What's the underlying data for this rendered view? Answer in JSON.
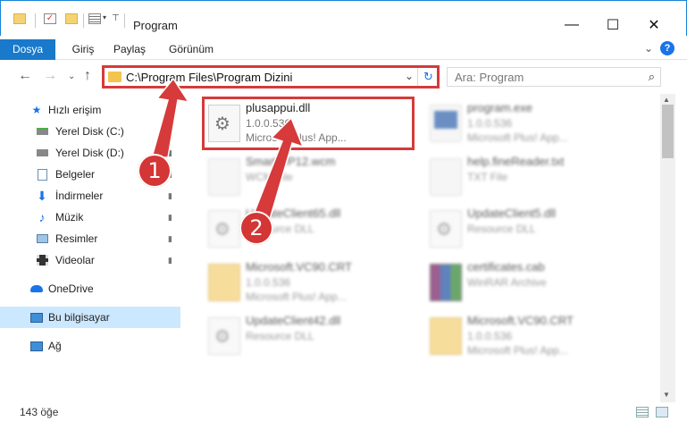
{
  "window": {
    "title": "Program",
    "minimize": "—",
    "maximize": "☐",
    "close": "✕"
  },
  "ribbon": {
    "tabs": [
      {
        "label": "Dosya",
        "active": true
      },
      {
        "label": "Giriş",
        "active": false
      },
      {
        "label": "Paylaş",
        "active": false
      },
      {
        "label": "Görünüm",
        "active": false
      }
    ],
    "expand_icon": "⌄",
    "help": "?"
  },
  "navigation": {
    "back": "←",
    "forward": "→",
    "recent": "⌄",
    "up": "↑"
  },
  "address": {
    "path": "C:\\Program Files\\Program Dizini",
    "dropdown": "⌄",
    "refresh": "↻"
  },
  "search": {
    "placeholder": "Ara: Program",
    "icon": "⌕"
  },
  "sidebar": {
    "items": [
      {
        "label": "Hızlı erişim",
        "icon": "star-icon",
        "pinned": false
      },
      {
        "label": "Yerel Disk (C:)",
        "icon": "drive-icon",
        "pinned": true
      },
      {
        "label": "Yerel Disk (D:)",
        "icon": "drive-icon",
        "pinned": true
      },
      {
        "label": "Belgeler",
        "icon": "documents-icon",
        "pinned": true
      },
      {
        "label": "İndirmeler",
        "icon": "download-icon",
        "pinned": true
      },
      {
        "label": "Müzik",
        "icon": "music-icon",
        "pinned": true
      },
      {
        "label": "Resimler",
        "icon": "pictures-icon",
        "pinned": true
      },
      {
        "label": "Videolar",
        "icon": "videos-icon",
        "pinned": true
      },
      {
        "label": "OneDrive",
        "icon": "cloud-icon",
        "pinned": false
      },
      {
        "label": "Bu bilgisayar",
        "icon": "computer-icon",
        "pinned": false,
        "selected": true
      },
      {
        "label": "Ağ",
        "icon": "network-icon",
        "pinned": false
      }
    ],
    "pin_glyph": "📌"
  },
  "files": [
    {
      "name": "plusappui.dll",
      "line2": "1.0.0.536",
      "line3": "Microsoft Plus! App...",
      "icon": "dll-gear-icon",
      "highlighted": true
    },
    {
      "name": "program.exe",
      "line2": "1.0.0.536",
      "line3": "Microsoft Plus! App...",
      "icon": "exe-icon"
    },
    {
      "name": "SmartWP12.wcm",
      "line2": "WCM File",
      "line3": "",
      "icon": "blank-file-icon"
    },
    {
      "name": "help.fineReader.txt",
      "line2": "TXT File",
      "line3": "",
      "icon": "blank-file-icon"
    },
    {
      "name": "UpdateClient65.dll",
      "line2": "Resource DLL",
      "line3": "",
      "icon": "dll-gear-icon"
    },
    {
      "name": "UpdateClient5.dll",
      "line2": "Resource DLL",
      "line3": "",
      "icon": "dll-gear-icon"
    },
    {
      "name": "Microsoft.VC90.CRT",
      "line2": "1.0.0.536",
      "line3": "Microsoft Plus! App...",
      "icon": "folder-file-icon"
    },
    {
      "name": "certificates.cab",
      "line2": "WinRAR Archive",
      "line3": "",
      "icon": "rar-icon"
    },
    {
      "name": "UpdateClient42.dll",
      "line2": "Resource DLL",
      "line3": "",
      "icon": "dll-gear-icon"
    },
    {
      "name": "Microsoft.VC90.CRT",
      "line2": "1.0.0.536",
      "line3": "Microsoft Plus! App...",
      "icon": "folder-file-icon"
    }
  ],
  "status": {
    "count": "143 öğe"
  },
  "annotations": {
    "step1": "1",
    "step2": "2",
    "color": "#d63a3a"
  }
}
